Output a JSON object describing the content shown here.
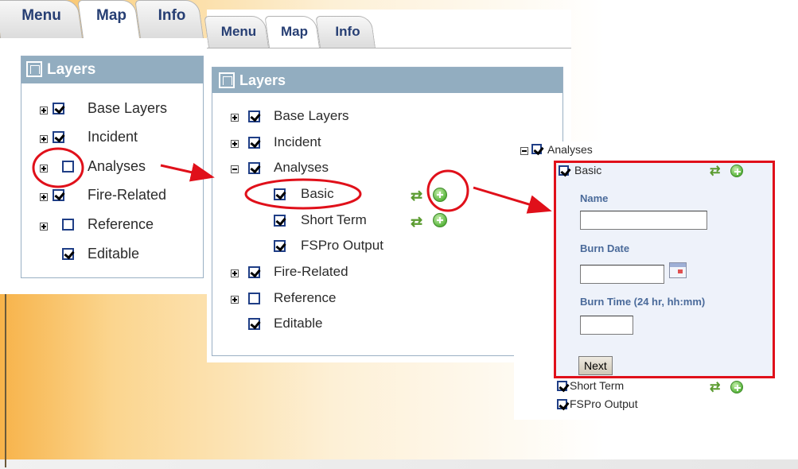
{
  "tabs": [
    "Menu",
    "Map",
    "Info"
  ],
  "active_tab": "Map",
  "layers_title": "Layers",
  "panel1": {
    "items": [
      {
        "label": "Base Layers",
        "checked": true,
        "expander": "plus"
      },
      {
        "label": "Incident",
        "checked": true,
        "expander": "plus"
      },
      {
        "label": "Analyses",
        "checked": false,
        "expander": "plus"
      },
      {
        "label": "Fire-Related",
        "checked": true,
        "expander": "plus"
      },
      {
        "label": "Reference",
        "checked": false,
        "expander": "plus"
      },
      {
        "label": "Editable",
        "checked": true,
        "expander": "none"
      }
    ]
  },
  "panel2": {
    "items": [
      {
        "label": "Base Layers",
        "checked": true
      },
      {
        "label": "Incident",
        "checked": true
      },
      {
        "label": "Analyses",
        "checked": true
      },
      {
        "label": "Basic",
        "checked": true
      },
      {
        "label": "Short Term",
        "checked": true
      },
      {
        "label": "FSPro Output",
        "checked": true
      },
      {
        "label": "Fire-Related",
        "checked": true
      },
      {
        "label": "Reference",
        "checked": false
      },
      {
        "label": "Editable",
        "checked": true
      }
    ]
  },
  "panel3": {
    "group": {
      "label": "Analyses",
      "checked": true
    },
    "basic": {
      "label": "Basic",
      "checked": true
    },
    "form": {
      "name_label": "Name",
      "burn_date_label": "Burn Date",
      "burn_time_label": "Burn Time (24 hr, hh:mm)",
      "name_value": "",
      "burn_date_value": "",
      "burn_time_value": "",
      "next_label": "Next"
    },
    "after_items": [
      {
        "label": "Short Term",
        "checked": true
      },
      {
        "label": "FSPro Output",
        "checked": true
      }
    ]
  },
  "colors": {
    "tab_text": "#263e73",
    "header_bg": "#92adc0",
    "annotation_red": "#e0101a",
    "checkbox_border": "#1f3e86",
    "add_icon_green": "#59b53d"
  },
  "icons": [
    "expand-plus-icon",
    "collapse-minus-icon",
    "checkbox-icon",
    "refresh-icon",
    "add-icon",
    "calendar-icon",
    "layers-icon"
  ]
}
